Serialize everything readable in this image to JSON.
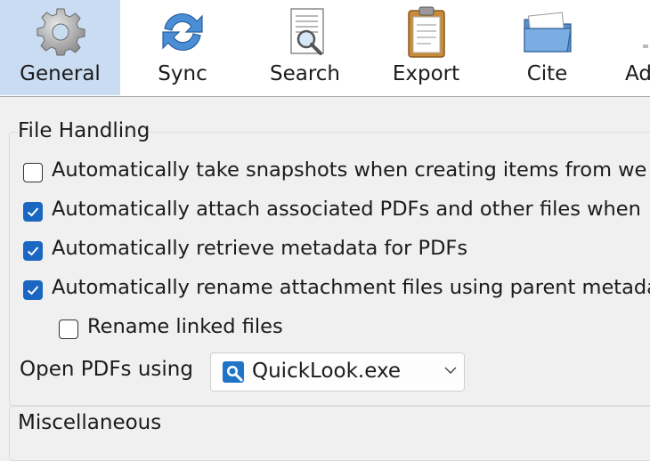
{
  "toolbar": {
    "tabs": [
      {
        "label": "General",
        "icon": "gear-icon",
        "selected": true
      },
      {
        "label": "Sync",
        "icon": "sync-icon",
        "selected": false
      },
      {
        "label": "Search",
        "icon": "search-document-icon",
        "selected": false
      },
      {
        "label": "Export",
        "icon": "clipboard-icon",
        "selected": false
      },
      {
        "label": "Cite",
        "icon": "folder-icon",
        "selected": false
      },
      {
        "label": "Ad",
        "icon": "advanced-icon",
        "selected": false
      }
    ],
    "selected_color": "#c9dcf2"
  },
  "file_handling": {
    "title": "File Handling",
    "options": [
      {
        "label": "Automatically take snapshots when creating items from we",
        "checked": false
      },
      {
        "label": "Automatically attach associated PDFs and other files when",
        "checked": true
      },
      {
        "label": "Automatically retrieve metadata for PDFs",
        "checked": true
      },
      {
        "label": "Automatically rename attachment files using parent metada",
        "checked": true
      },
      {
        "label": "Rename linked files",
        "checked": false
      }
    ],
    "open_pdfs_label": "Open PDFs using",
    "open_pdfs_value": "QuickLook.exe",
    "checkbox_color": "#1a67c1"
  },
  "miscellaneous": {
    "title": "Miscellaneous"
  }
}
